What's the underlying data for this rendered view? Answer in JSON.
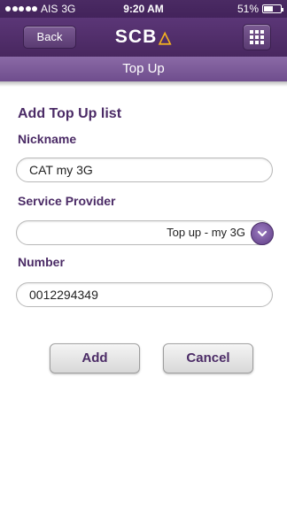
{
  "status_bar": {
    "carrier": "AIS",
    "network": "3G",
    "time": "9:20 AM",
    "battery": "51%",
    "battery_level": 0.51
  },
  "header": {
    "back_label": "Back",
    "logo_text": "SCB",
    "menu_icon": "grid-icon"
  },
  "title_bar": {
    "title": "Top Up"
  },
  "form": {
    "title": "Add Top Up list",
    "nickname_label": "Nickname",
    "nickname_value": "CAT my 3G",
    "provider_label": "Service Provider",
    "provider_value": "Top up - my 3G",
    "number_label": "Number",
    "number_value": "0012294349"
  },
  "actions": {
    "add_label": "Add",
    "cancel_label": "Cancel"
  },
  "colors": {
    "header_purple": "#48275f",
    "accent_purple": "#4b2b66",
    "logo_gold": "#f5b21e"
  }
}
